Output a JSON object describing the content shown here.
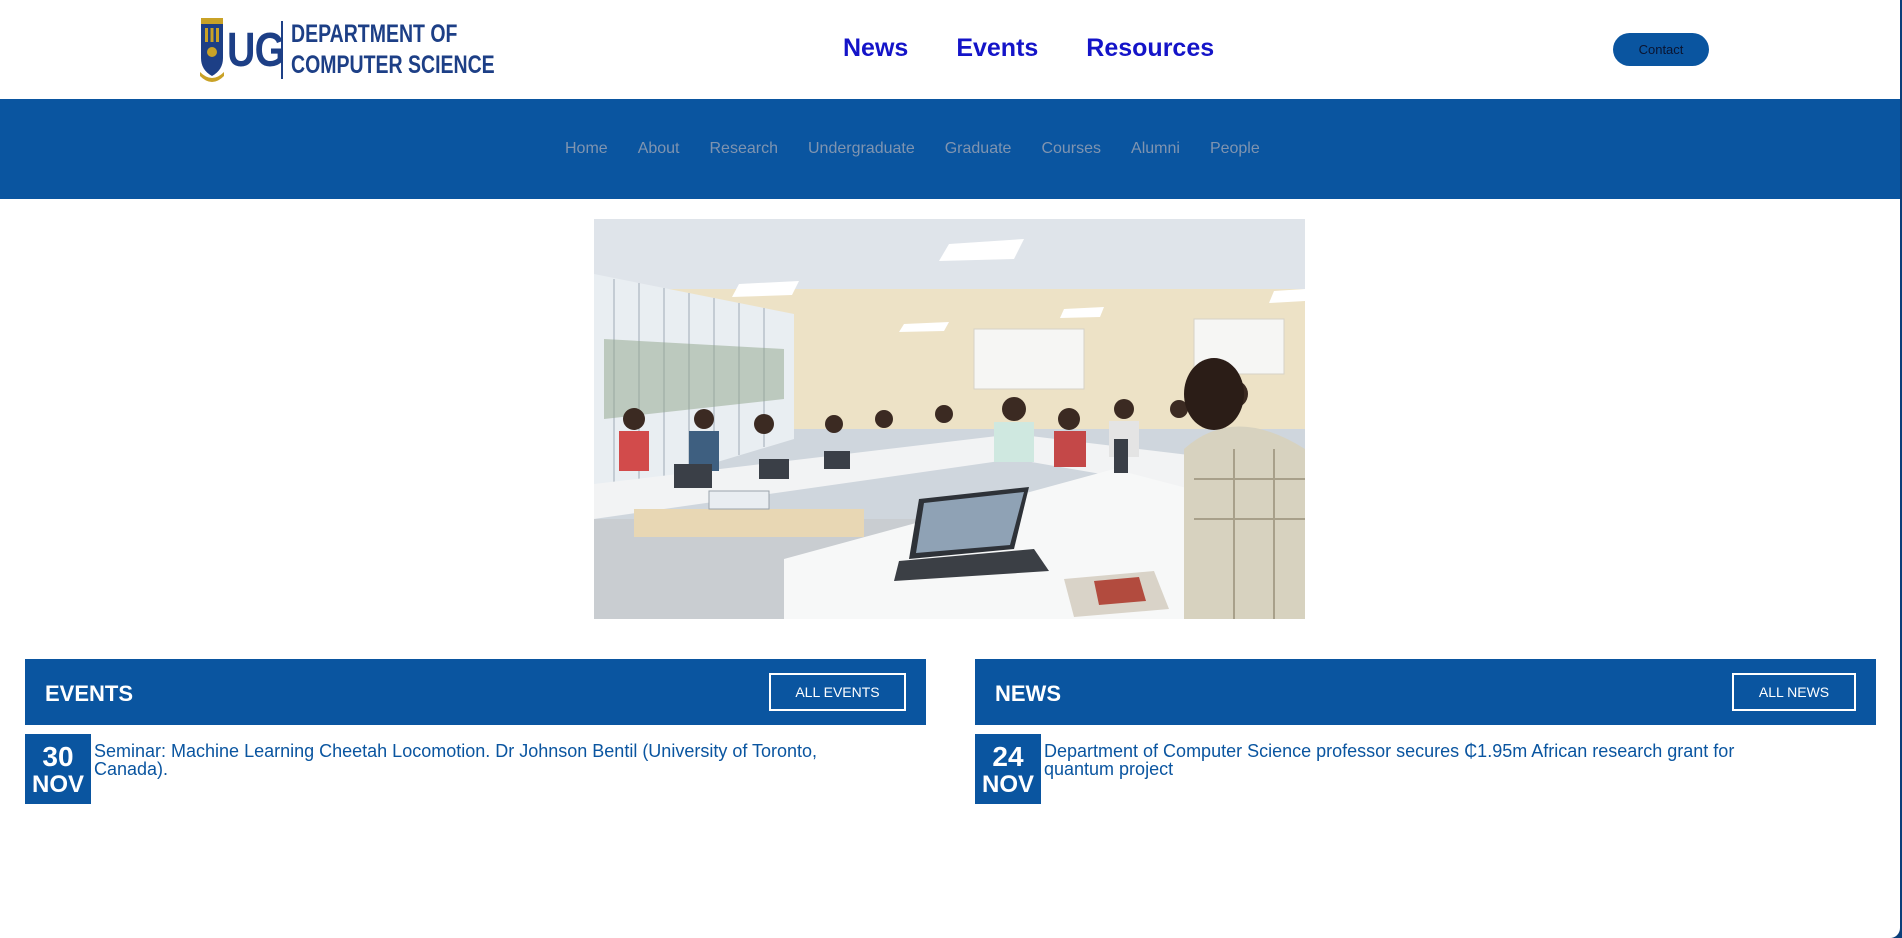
{
  "logo": {
    "mark": "UG",
    "line1": "DEPARTMENT OF",
    "line2": "COMPUTER SCIENCE",
    "crest_icon": "university-crest-icon"
  },
  "top_nav": [
    {
      "label": "News"
    },
    {
      "label": "Events"
    },
    {
      "label": "Resources"
    }
  ],
  "contact": {
    "label": "Contact"
  },
  "secondary_nav": [
    {
      "label": "Home"
    },
    {
      "label": "About"
    },
    {
      "label": "Research"
    },
    {
      "label": "Undergraduate"
    },
    {
      "label": "Graduate"
    },
    {
      "label": "Courses"
    },
    {
      "label": "Alumni"
    },
    {
      "label": "People"
    }
  ],
  "hero": {
    "image": "classroom-students-with-laptops"
  },
  "events": {
    "title": "EVENTS",
    "all_label": "ALL EVENTS",
    "items": [
      {
        "day": "30",
        "month": "NOV",
        "text": "Seminar: Machine Learning Cheetah Locomotion. Dr Johnson Bentil (University of Toronto, Canada)."
      }
    ]
  },
  "news": {
    "title": "NEWS",
    "all_label": "ALL NEWS",
    "items": [
      {
        "day": "24",
        "month": "NOV",
        "text": "Department of Computer Science professor secures ₵1.95m African research grant for quantum project"
      }
    ]
  },
  "colors": {
    "brand_blue": "#0a55a0",
    "nav_link": "#1414c8",
    "logo_navy": "#1d3f86",
    "secondary_nav_text": "#7f94b0"
  }
}
